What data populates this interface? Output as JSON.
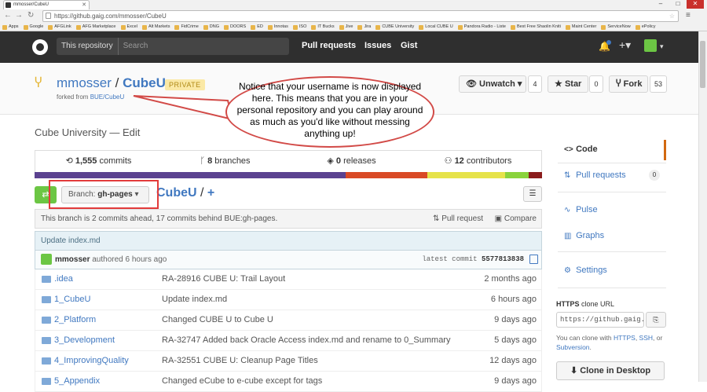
{
  "browser": {
    "tab_title": "mmosser/CubeU",
    "url": "https://github.gaig.com/mmosser/CubeU",
    "bookmarks": [
      "Apps",
      "Google",
      "AFGLink",
      "AFG Marketplace",
      "Excel",
      "Alt Markets",
      "FidCrime",
      "DNG",
      "DOORS",
      "ED",
      "Innotas",
      "ISO",
      "IT Bucks",
      "Jive",
      "Jira",
      "CUBE University",
      "Local CUBE U",
      "Pandora Radio - Liste",
      "Best Free Shaolin Kniti",
      "Maint Center",
      "ServiceNow",
      "ePolicy"
    ]
  },
  "header": {
    "scope_label": "This repository",
    "search_placeholder": "Search",
    "nav": [
      "Pull requests",
      "Issues",
      "Gist"
    ]
  },
  "repo": {
    "owner": "mmosser",
    "name": "CubeU",
    "badge": "PRIVATE",
    "forked_prefix": "forked from ",
    "forked_link": "BUE/CubeU",
    "unwatch_label": "Unwatch",
    "watch_count": "4",
    "star_label": "Star",
    "star_count": "0",
    "fork_label": "Fork",
    "fork_count": "53",
    "description": "Cube University — Edit"
  },
  "stats": {
    "commits": "1,555",
    "commits_label": "commits",
    "branches": "8",
    "branches_label": "branches",
    "releases": "0",
    "releases_label": "releases",
    "contributors": "12",
    "contributors_label": "contributors"
  },
  "langbar_colors": [
    "#5b4290",
    "#5b4290",
    "#d94a26",
    "#e6e34a",
    "#8ad33b",
    "#8b1c1c"
  ],
  "branch": {
    "prefix": "Branch: ",
    "name": "gh-pages",
    "crumb_repo": "CubeU",
    "crumb_sep": "/",
    "crumb_plus": "+"
  },
  "ahead": {
    "text": "This branch is 2 commits ahead, 17 commits behind BUE:gh-pages.",
    "pull_request": "Pull request",
    "compare": "Compare"
  },
  "commit": {
    "message": "Update index.md",
    "author": "mmosser",
    "authored": "authored 6 hours ago",
    "latest_label": "latest commit",
    "sha": "5577813838"
  },
  "files": [
    {
      "name": ".idea",
      "message": "RA-28916 CUBE U: Trail Layout",
      "age": "2 months ago"
    },
    {
      "name": "1_CubeU",
      "message": "Update index.md",
      "age": "6 hours ago"
    },
    {
      "name": "2_Platform",
      "message": "Changed CUBE U to Cube U",
      "age": "9 days ago"
    },
    {
      "name": "3_Development",
      "message": "RA-32747 Added back Oracle Access index.md and rename to 0_Summary",
      "age": "5 days ago"
    },
    {
      "name": "4_ImprovingQuality",
      "message": "RA-32551 CUBE U: Cleanup Page Titles",
      "age": "12 days ago"
    },
    {
      "name": "5_Appendix",
      "message": "Changed eCube to e-cube except for tags",
      "age": "9 days ago"
    }
  ],
  "sidebar": {
    "code": "Code",
    "pull_requests": "Pull requests",
    "pr_count": "0",
    "pulse": "Pulse",
    "graphs": "Graphs",
    "settings": "Settings",
    "https_label": "HTTPS",
    "clone_url_label": "clone URL",
    "clone_url": "https://github.gaig.com/mmosser/CubeU.git",
    "clone_note_prefix": "You can clone with ",
    "clone_https": "HTTPS",
    "clone_ssh": "SSH",
    "clone_or": ", or ",
    "clone_subversion": "Subversion",
    "clone_end": ".",
    "clone_desktop": "Clone in Desktop"
  },
  "callout": {
    "text": "Notice that your username is now displayed here.  This means that you are in your personal repository and you can play around as much as you'd like without messing anything up!"
  }
}
